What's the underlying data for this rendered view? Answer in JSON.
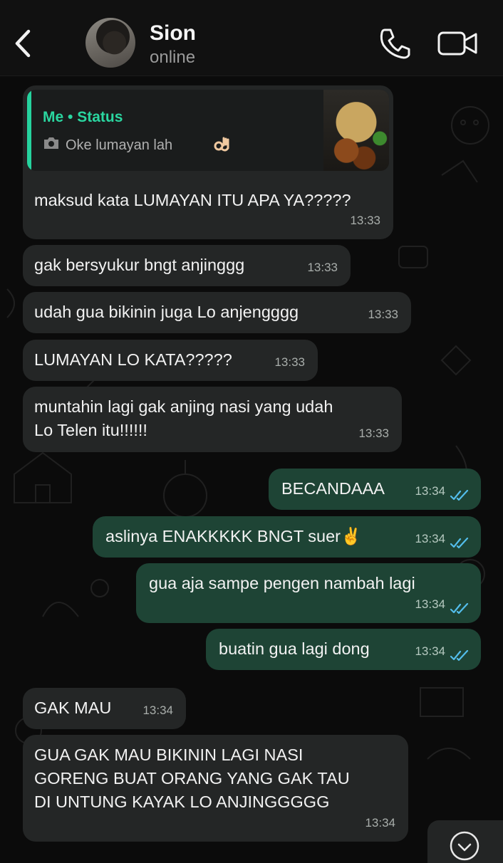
{
  "header": {
    "contact_name": "Sion",
    "status": "online"
  },
  "quoted_status": {
    "author": "Me • Status",
    "text": "Oke lumayan lah"
  },
  "messages": [
    {
      "direction": "in",
      "text": "maksud kata LUMAYAN ITU APA YA?????",
      "time": "13:33"
    },
    {
      "direction": "in",
      "text": "gak bersyukur bngt anjinggg",
      "time": "13:33"
    },
    {
      "direction": "in",
      "text": "udah gua bikinin juga Lo anjengggg",
      "time": "13:33"
    },
    {
      "direction": "in",
      "text": "LUMAYAN LO KATA?????",
      "time": "13:33"
    },
    {
      "direction": "in",
      "text": "muntahin lagi gak anjing nasi yang udah\nLo Telen itu!!!!!!",
      "time": "13:33"
    },
    {
      "direction": "out",
      "text": "BECANDAAA",
      "time": "13:34",
      "read": true
    },
    {
      "direction": "out",
      "text": "aslinya ENAKKKKK BNGT suer✌️",
      "time": "13:34",
      "read": true
    },
    {
      "direction": "out",
      "text": "gua aja sampe pengen nambah lagi",
      "time": "13:34",
      "read": true
    },
    {
      "direction": "out",
      "text": "buatin gua lagi dong",
      "time": "13:34",
      "read": true
    },
    {
      "direction": "in",
      "text": "GAK MAU",
      "time": "13:34"
    },
    {
      "direction": "in",
      "text": "GUA GAK MAU BIKININ LAGI NASI\nGORENG BUAT ORANG YANG GAK TAU\nDI UNTUNG KAYAK LO ANJINGGGGG",
      "time": "13:34"
    }
  ],
  "colors": {
    "incoming_bubble": "#242626",
    "outgoing_bubble": "#1e4435",
    "accent": "#25d39e",
    "read_ticks": "#53bdeb"
  },
  "icons": [
    "back-chevron-icon",
    "phone-icon",
    "video-camera-icon",
    "camera-icon",
    "ok-hand-emoji",
    "double-check-icon",
    "chevron-down-icon"
  ]
}
